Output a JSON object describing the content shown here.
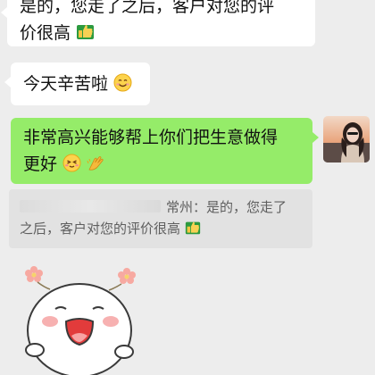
{
  "messages": {
    "m1_line1": "是的，您走了之后，客户对您的评",
    "m1_line2": "价很高",
    "m2": "今天辛苦啦",
    "m3_line1": "非常高兴能够帮上你们把生意做得",
    "m3_line2": "更好"
  },
  "quote": {
    "line1": "常州：是的，您走了",
    "line2": "之后，客户对您的评价很高"
  },
  "icons": {
    "thumbs": "thumbs-up-emoji",
    "smile": "smile-emoji",
    "blush": "blush-emoji",
    "clap": "clap-emoji"
  },
  "colors": {
    "background": "#ededed",
    "incoming_bubble": "#ffffff",
    "outgoing_bubble": "#95ec69",
    "quote_bg": "#e2e2e2"
  }
}
